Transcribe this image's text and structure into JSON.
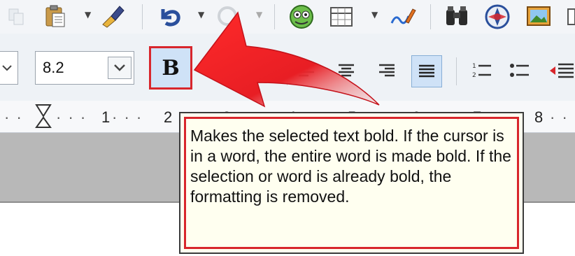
{
  "font_size": {
    "value": "8.2"
  },
  "bold_button": {
    "label": "B"
  },
  "ruler": {
    "leading_dots": "· ·",
    "numbers": [
      "1",
      "2",
      "3",
      "4",
      "5",
      "6",
      "7",
      "8"
    ],
    "trailing_dots": "· ·"
  },
  "tooltip": {
    "text": "Makes the selected text bold. If the cursor is in a word, the entire word is made bold. If the selection or word is already bold, the formatting is removed."
  },
  "icons": {
    "toolbar_top": [
      "paste-icon",
      "clone-formatting-icon",
      "undo-icon",
      "redo-icon",
      "navigator-icon",
      "table-icon",
      "draw-functions-icon",
      "find-icon",
      "gallery-icon",
      "hyperlink-icon",
      "image-icon"
    ],
    "toolbar_format": [
      "align-left-icon",
      "align-center-icon",
      "align-right-icon",
      "justify-icon",
      "numbering-icon",
      "bullets-icon",
      "indent-icon"
    ]
  },
  "colors": {
    "highlight_red": "#d8262c",
    "button_active_blue": "#cfe2f7",
    "tooltip_background": "#fffff0"
  }
}
